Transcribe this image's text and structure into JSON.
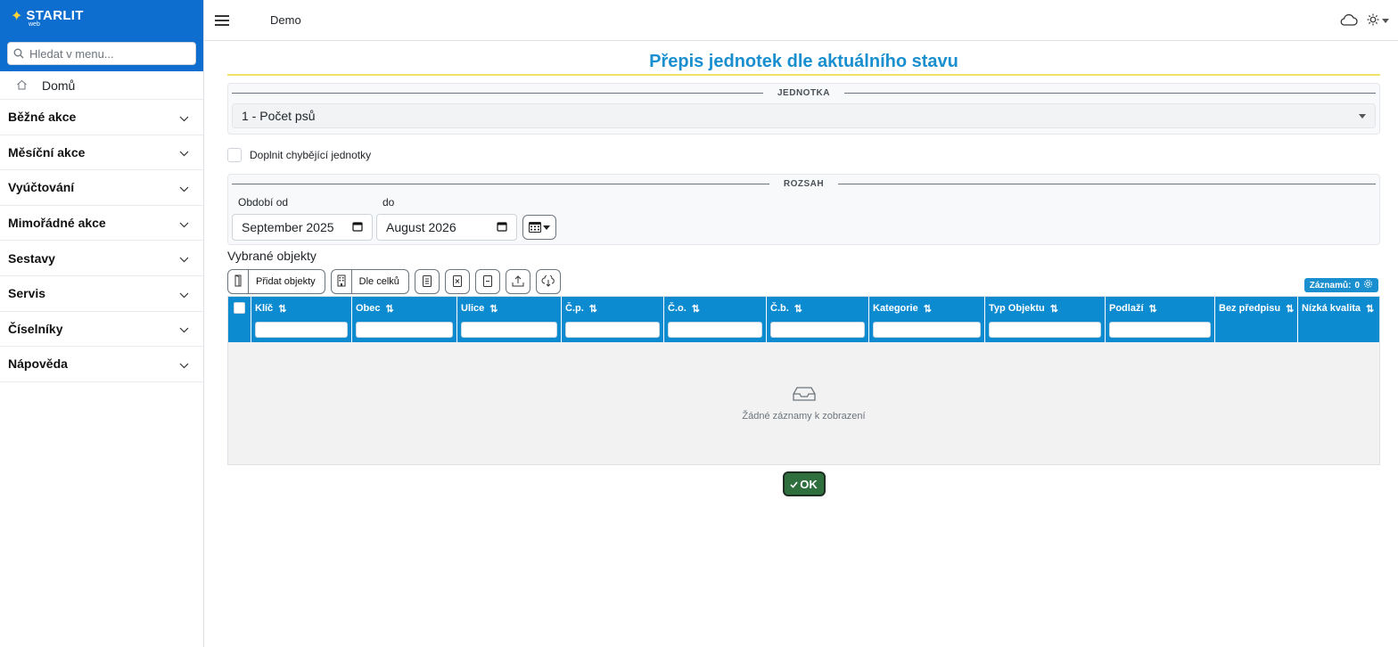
{
  "app": {
    "brand": "STARLIT",
    "brand_sub": "web",
    "name": "Demo"
  },
  "sidebar": {
    "search_placeholder": "Hledat v menu...",
    "home_label": "Domů",
    "items": [
      {
        "label": "Běžné akce"
      },
      {
        "label": "Měsíční akce"
      },
      {
        "label": "Vyúčtování"
      },
      {
        "label": "Mimořádné akce"
      },
      {
        "label": "Sestavy"
      },
      {
        "label": "Servis"
      },
      {
        "label": "Číselníky"
      },
      {
        "label": "Nápověda"
      }
    ]
  },
  "page": {
    "title": "Přepis jednotek dle aktuálního stavu",
    "unit_legend": "JEDNOTKA",
    "unit_value": "1 - Počet psů",
    "fill_missing_label": "Doplnit chybějící jednotky",
    "range_legend": "ROZSAH",
    "period_from_label": "Období od",
    "period_to_label": "do",
    "period_from_value": "September 2025",
    "period_to_value": "August 2026",
    "selected_objects_label": "Vybrané objekty",
    "add_objects_label": "Přidat objekty",
    "by_units_label": "Dle celků",
    "records_label": "Záznamů:",
    "records_count": "0",
    "columns": [
      {
        "label": "Klíč"
      },
      {
        "label": "Obec"
      },
      {
        "label": "Ulice"
      },
      {
        "label": "Č.p."
      },
      {
        "label": "Č.o."
      },
      {
        "label": "Č.b."
      },
      {
        "label": "Kategorie"
      },
      {
        "label": "Typ Objektu"
      },
      {
        "label": "Podlaží"
      },
      {
        "label": "Bez předpisu"
      },
      {
        "label": "Nízká kvalita"
      }
    ],
    "empty_message": "Žádné záznamy k zobrazení",
    "ok_label": "OK"
  },
  "colors": {
    "header_blue": "#0d6ecf",
    "title_blue": "#1a8fcf",
    "grid_header": "#0d8bd0",
    "ok_green": "#2f6f3e",
    "title_underline": "#f0e36a"
  }
}
